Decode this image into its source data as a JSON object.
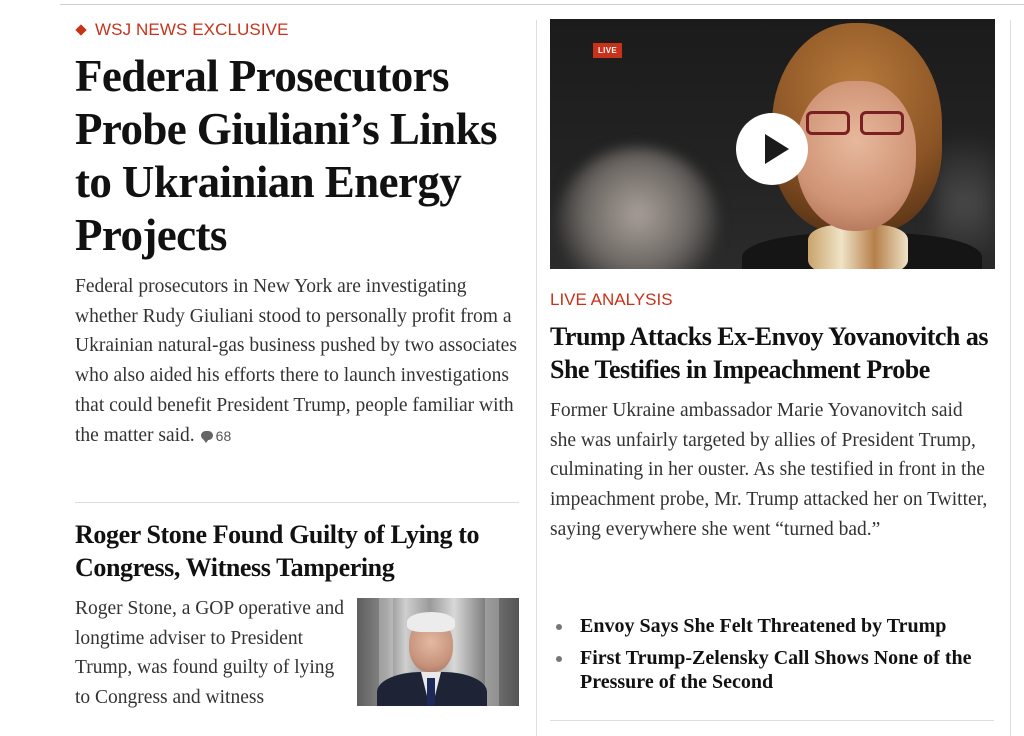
{
  "lead": {
    "flashline": "WSJ NEWS EXCLUSIVE",
    "headline": "Federal Prosecutors Probe Giuliani’s Links to Ukrainian Energy Projects",
    "summary": "Federal prosecutors in New York are investigating whether Rudy Giuliani stood to personally profit from a Ukrainian natural-gas business pushed by two associates who also aided his efforts there to launch investigations that could benefit President Trump, people familiar with the matter said.",
    "comment_count": "68"
  },
  "story2": {
    "headline": "Roger Stone Found Guilty of Lying to Congress, Witness Tampering",
    "summary": "Roger Stone, a GOP operative and longtime adviser to President Trump, was found guilty of lying to Congress and witness"
  },
  "video": {
    "live_label": "LIVE"
  },
  "story3": {
    "flashline": "LIVE ANALYSIS",
    "headline": "Trump Attacks Ex-Envoy Yovanovitch as She Testifies in Impeachment Probe",
    "summary": "Former Ukraine ambassador Marie Yovanovitch said she was unfairly targeted by allies of President Trump, culminating in her ouster. As she testified in front in the impeachment probe, Mr. Trump attacked her on Twitter, saying everywhere she went “turned bad.”",
    "related": [
      "Envoy Says She Felt Threatened by Trump",
      "First Trump-Zelensky Call Shows None of the Pressure of the Second"
    ]
  },
  "colors": {
    "flash_red": "#c9321a",
    "rule_gray": "#dedede"
  }
}
